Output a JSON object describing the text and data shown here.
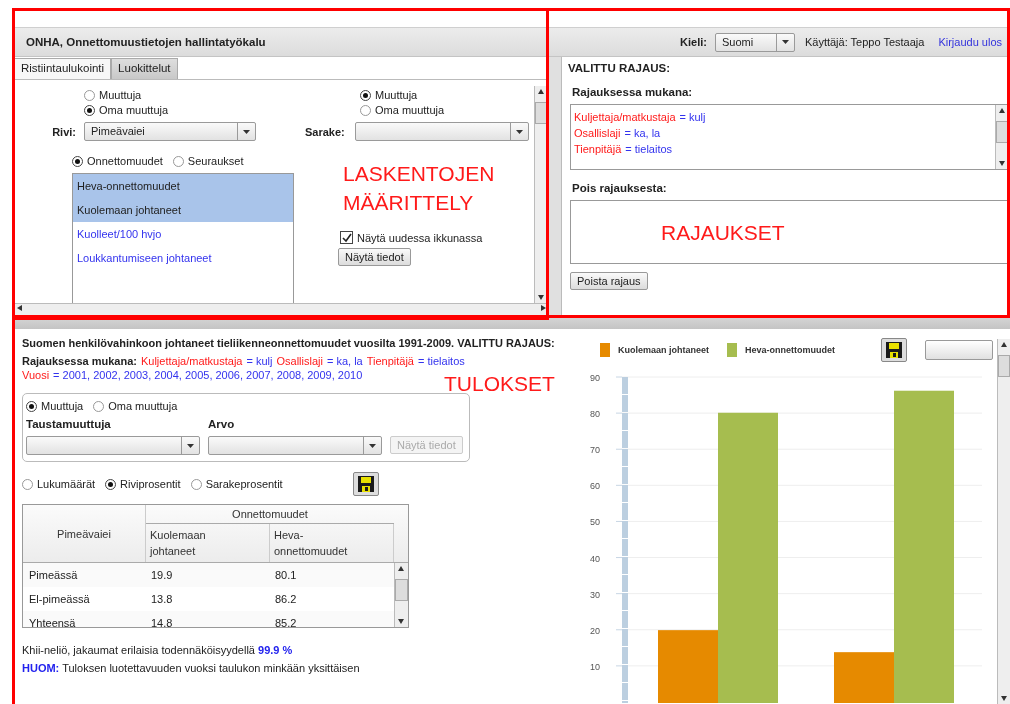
{
  "header": {
    "title": "ONHA, Onnettomuustietojen hallintatyökalu",
    "language_label": "Kieli:",
    "language": "Suomi",
    "user": "Käyttäjä: Teppo Testaaja",
    "logout": "Kirjaudu ulos"
  },
  "calc_panel": {
    "tabs": [
      {
        "label": "Ristiintaulukointi",
        "selected": true
      },
      {
        "label": "Luokittelut",
        "selected": false
      }
    ],
    "row_source": [
      {
        "label": "Muuttuja",
        "selected": false
      },
      {
        "label": "Oma muuttuja",
        "selected": true
      }
    ],
    "row_label": "Rivi:",
    "row_value": "Pimeävaiei",
    "column_source": [
      {
        "label": "Muuttuja",
        "selected": true
      },
      {
        "label": "Oma muuttuja",
        "selected": false
      }
    ],
    "column_label": "Sarake:",
    "measure_types": [
      {
        "label": "Onnettomuudet",
        "selected": true
      },
      {
        "label": "Seuraukset",
        "selected": false
      }
    ],
    "measures": [
      {
        "label": "Heva-onnettomuudet",
        "selected": true
      },
      {
        "label": "Kuolemaan johtaneet",
        "selected": true
      },
      {
        "label": "Kuolleet/100 hvjo",
        "selected": false
      },
      {
        "label": "Loukkantumiseen johtaneet",
        "selected": false
      }
    ],
    "annotation": [
      "LASKENTOJEN",
      "MÄÄRITTELY"
    ],
    "new_window": {
      "label": "Näytä uudessa ikkunassa",
      "checked": true
    },
    "show_button": "Näytä tiedot"
  },
  "filter_panel": {
    "title": "VALITTU RAJAUS:",
    "included_label": "Rajauksessa mukana:",
    "included": [
      {
        "key": "Kuljettaja/matkustaja",
        "value": "= kulj"
      },
      {
        "key": "Osallislaji",
        "value": "= ka, la"
      },
      {
        "key": "Tienpitäjä",
        "value": "= tielaitos"
      }
    ],
    "excluded_label": "Pois rajauksesta:",
    "annotation": "RAJAUKSET",
    "remove_button": "Poista rajaus"
  },
  "results": {
    "title": "Suomen henkilövahinkoon johtaneet tieliikenneonnettomuudet vuosilta 1991-2009. VALITTU RAJAUS:",
    "included_label": "Rajauksessa mukana:",
    "included": [
      {
        "key": "Kuljettaja/matkustaja",
        "value": "= kulj"
      },
      {
        "key": "Osallislaji",
        "value": "= ka, la"
      },
      {
        "key": "Tienpitäjä",
        "value": "= tielaitos"
      },
      {
        "key": "Vuosi",
        "value": "= 2001, 2002, 2003, 2004, 2005, 2006, 2007, 2008, 2009, 2010"
      }
    ],
    "annotation": "TULOKSET",
    "background": {
      "sources": [
        {
          "label": "Muuttuja",
          "selected": true
        },
        {
          "label": "Oma muuttuja",
          "selected": false
        }
      ],
      "variable_label": "Taustamuuttuja",
      "value_label": "Arvo",
      "show_button": {
        "label": "Näytä tiedot",
        "disabled": true
      }
    },
    "modes": [
      {
        "label": "Lukumäärät",
        "selected": false
      },
      {
        "label": "Riviprosentit",
        "selected": true
      },
      {
        "label": "Sarakeprosentit",
        "selected": false
      }
    ],
    "table": {
      "row_header": "Pimeävaiei",
      "group_header": "Onnettomuudet",
      "columns": [
        "Kuolemaan johtaneet",
        "Heva-onnettomuudet"
      ],
      "rows": [
        {
          "label": "Pimeässä",
          "values": [
            "19.9",
            "80.1"
          ]
        },
        {
          "label": "El-pimeässä",
          "values": [
            "13.8",
            "86.2"
          ]
        },
        {
          "label": "Yhteensä",
          "values": [
            "14.8",
            "85.2"
          ]
        }
      ]
    },
    "chi_text": "Khii-neliö, jakaumat erilaisia todennäköisyydellä",
    "chi_value": "99.9 %",
    "note_label": "HUOM:",
    "note": "Tuloksen luotettavuuden vuoksi taulukon minkään yksittäisen"
  },
  "chart": {
    "chart_data": {
      "type": "bar",
      "grid": true,
      "ylim": [
        0,
        90
      ],
      "yticks": [
        10,
        20,
        30,
        40,
        50,
        60,
        70,
        80,
        90
      ],
      "series": [
        {
          "name": "Kuolemaan johtaneet",
          "color": "#e68a00",
          "values": [
            19.9,
            13.8
          ]
        },
        {
          "name": "Heva-onnettomuudet",
          "color": "#a6bd4f",
          "values": [
            80.1,
            86.2
          ]
        }
      ]
    }
  }
}
